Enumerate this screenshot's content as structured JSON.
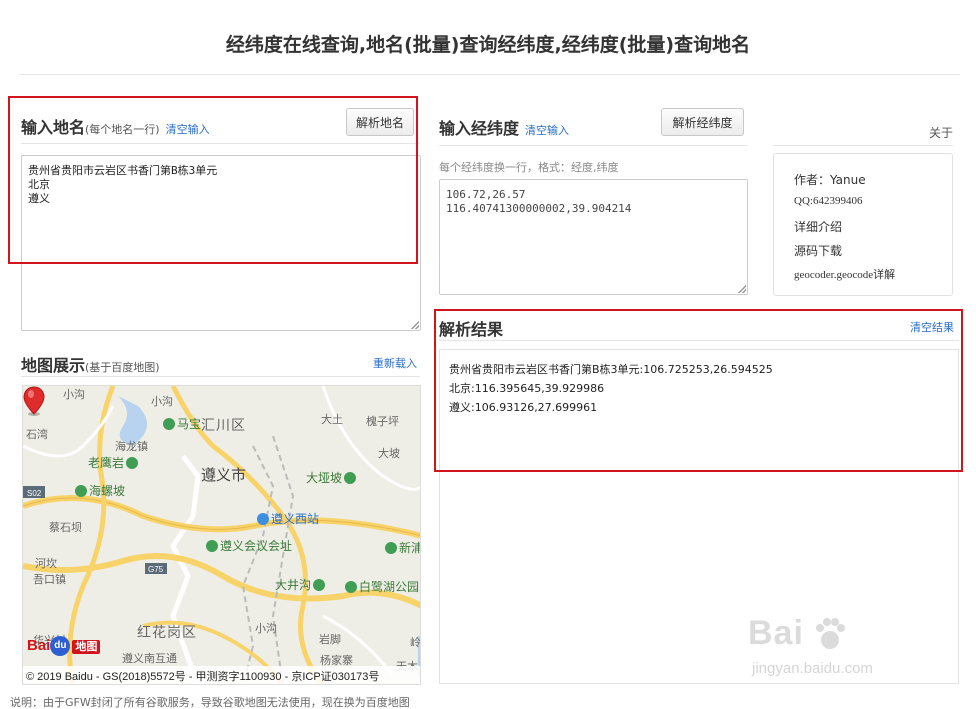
{
  "page_title": "经纬度在线查询,地名(批量)查询经纬度,经纬度(批量)查询地名",
  "place_input": {
    "heading": "输入地名",
    "subheading": "(每个地名一行)",
    "clear_link": "清空输入",
    "parse_button": "解析地名",
    "text": "贵州省贵阳市云岩区书香门第B栋3单元\n北京\n遵义"
  },
  "coord_input": {
    "heading": "输入经纬度",
    "clear_link": "清空输入",
    "parse_button": "解析经纬度",
    "hint": "每个经纬度换一行，格式：经度,纬度",
    "text": "106.72,26.57\n116.40741300000002,39.904214"
  },
  "about": {
    "link": "关于",
    "lines": [
      "作者：Yanue",
      "QQ:642399406",
      "详细介绍",
      "源码下载",
      "geocoder.geocode详解"
    ]
  },
  "results": {
    "heading": "解析结果",
    "clear_link": "清空结果",
    "lines": [
      "贵州省贵阳市云岩区书香门第B栋3单元:106.725253,26.594525",
      "北京:116.395645,39.929986",
      "遵义:106.93126,27.699961"
    ]
  },
  "map": {
    "heading": "地图展示",
    "subheading": "(基于百度地图)",
    "reload_link": "重新载入",
    "labels": {
      "xiaogou": "小沟",
      "xiaogou2": "小沟",
      "mabao": "马宝",
      "huichuan": "汇川区",
      "daishi": "大土",
      "kuaizi": "槐子坪",
      "shishi": "石湾",
      "haolong": "海龙镇",
      "dapo": "大坡",
      "laoyingyan": "老鹰岩",
      "zunyi_city": "遵义市",
      "dayapo": "大垭坡",
      "s02": "S02",
      "hailuopo": "海螺坡",
      "zunyi_west": "遵义西站",
      "caishiba": "蔡石坝",
      "huiyi": "遵义会议会址",
      "xinpu": "新浦",
      "hekan": "河坎",
      "g75": "G75",
      "kouzhen": "吾口镇",
      "dajinggou": "大井沟",
      "bailuhu": "白鹭湖公园",
      "honghuagang": "红花岗区",
      "xiaogou3": "小沟",
      "huaxingcun": "华兴村",
      "yanjiao": "岩脚",
      "yangjiazhai": "杨家寨",
      "zunyi_south": "遵义南互通",
      "tianmu": "天木",
      "lingzui": "岭嘴"
    },
    "logo_text": "Bai",
    "logo_du": "du",
    "logo_cn": "地图",
    "copyright": "© 2019 Baidu - GS(2018)5572号 - 甲测资字1100930 - 京ICP证030173号"
  },
  "footer_note": "说明：由于GFW封闭了所有谷歌服务，导致谷歌地图无法使用，现在换为百度地图",
  "watermark": {
    "main": "Bai",
    "sub": "jingyan.baidu.com"
  },
  "colors": {
    "accent_link": "#2a6ec9",
    "highlight_red": "#d0151c"
  }
}
